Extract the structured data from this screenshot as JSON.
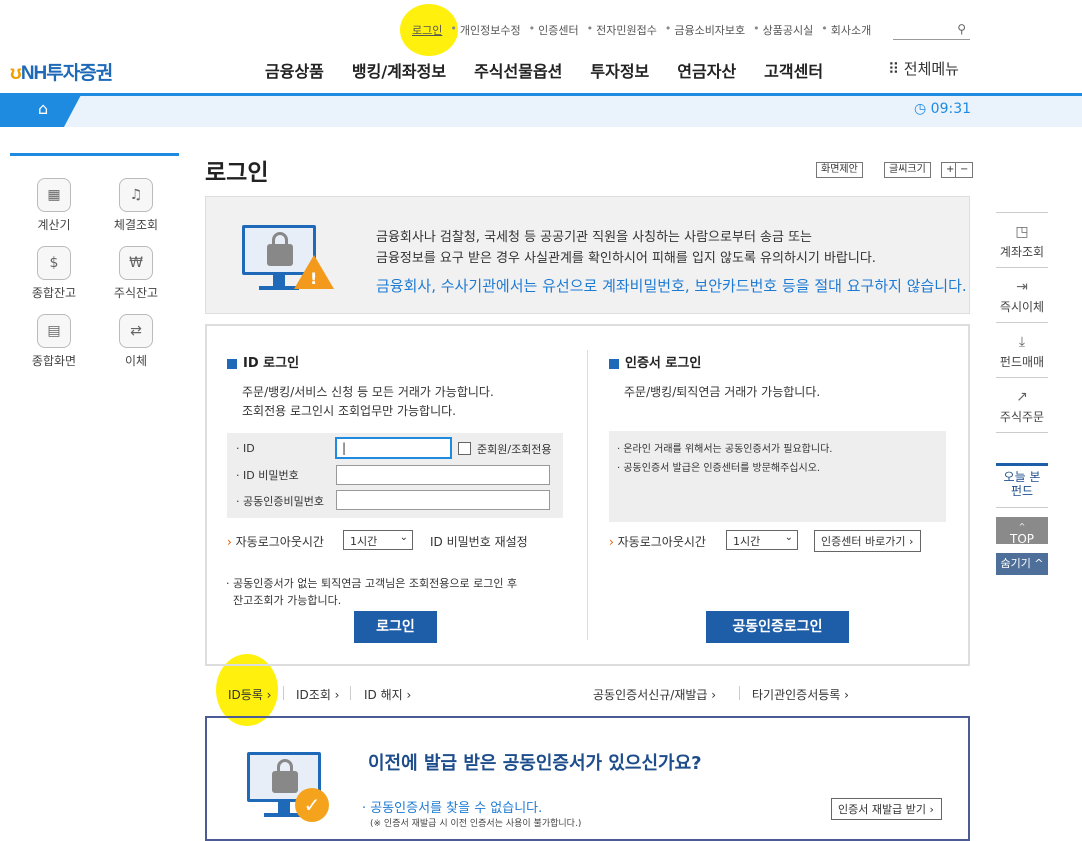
{
  "util_links": [
    "로그인",
    "개인정보수정",
    "인증센터",
    "전자민원접수",
    "금융소비자보호",
    "상품공시실",
    "회사소개"
  ],
  "logo": {
    "text": "NH투자증권"
  },
  "gnb": [
    "금융상품",
    "뱅킹/계좌정보",
    "주식선물옵션",
    "투자정보",
    "연금자산",
    "고객센터"
  ],
  "all_menu": "전체메뉴",
  "clock": "09:31",
  "left_quick": [
    {
      "label": "계산기",
      "icon": "calculator-icon"
    },
    {
      "label": "체결조회",
      "icon": "bell-check-icon"
    },
    {
      "label": "종합잔고",
      "icon": "money-bag-icon"
    },
    {
      "label": "주식잔고",
      "icon": "won-coin-icon"
    },
    {
      "label": "종합화면",
      "icon": "chart-screen-icon"
    },
    {
      "label": "이체",
      "icon": "transfer-icon"
    }
  ],
  "page_title": "로그인",
  "tools": {
    "suggest": "화면제안",
    "fontsize": "글씨크기",
    "plus": "+",
    "minus": "−"
  },
  "warning": {
    "line1": "금융회사나 검찰청, 국세청 등 공공기관 직원을 사칭하는 사람으로부터 송금 또는",
    "line2": "금융정보를 요구 받은 경우 사실관계를 확인하시어 피해를 입지 않도록 유의하시기 바랍니다.",
    "line3": "금융회사, 수사기관에서는 유선으로 계좌비밀번호, 보안카드번호 등을 절대 요구하지 않습니다."
  },
  "id_login": {
    "title": "ID 로그인",
    "desc1": "주문/뱅킹/서비스 신청 등 모든 거래가 가능합니다.",
    "desc2": "조회전용 로그인시 조회업무만 가능합니다.",
    "label_id": "ID",
    "label_pw": "ID 비밀번호",
    "label_cert_pw": "공동인증비밀번호",
    "id_value": "|",
    "readonly_check": "준회원/조회전용",
    "auto_logout_label": "자동로그아웃시간",
    "auto_logout_value": "1시간",
    "reset_pw": "ID 비밀번호 재설정",
    "note1": "공동인증서가 없는 퇴직연금 고객님은 조회전용으로 로그인 후",
    "note2": "잔고조회가 가능합니다.",
    "button": "로그인"
  },
  "cert_login": {
    "title": "인증서 로그인",
    "desc1": "주문/뱅킹/퇴직연금 거래가 가능합니다.",
    "info1": "온라인 거래를 위해서는 공동인증서가 필요합니다.",
    "info2": "공동인증서 발급은 인증센터를 방문해주십시오.",
    "auto_logout_label": "자동로그아웃시간",
    "auto_logout_value": "1시간",
    "cert_center_button": "인증센터 바로가기 ›",
    "button": "공동인증로그인"
  },
  "bottom_links": {
    "id_register": "ID등록 ›",
    "id_lookup": "ID조회 ›",
    "id_cancel": "ID 해지 ›",
    "cert_new": "공동인증서신규/재발급 ›",
    "cert_other": "타기관인증서등록 ›"
  },
  "cert_promo": {
    "title": "이전에 발급 받은 공동인증서가 있으신가요?",
    "sub": "공동인증서를 찾을 수 없습니다.",
    "note": "(※ 인증서 재발급 시 이전 인증서는 사용이 불가합니다.)",
    "button": "인증서 재발급 받기 ›"
  },
  "right_quick": [
    {
      "label": "계좌조회",
      "icon": "account-icon"
    },
    {
      "label": "즉시이체",
      "icon": "transfer-in-icon"
    },
    {
      "label": "펀드매매",
      "icon": "download-icon"
    },
    {
      "label": "주식주문",
      "icon": "trend-arrow-icon"
    }
  ],
  "right_extra": {
    "viewed_fund": "오늘 본\n펀드",
    "top": "TOP",
    "hide": "숨기기 ^"
  }
}
